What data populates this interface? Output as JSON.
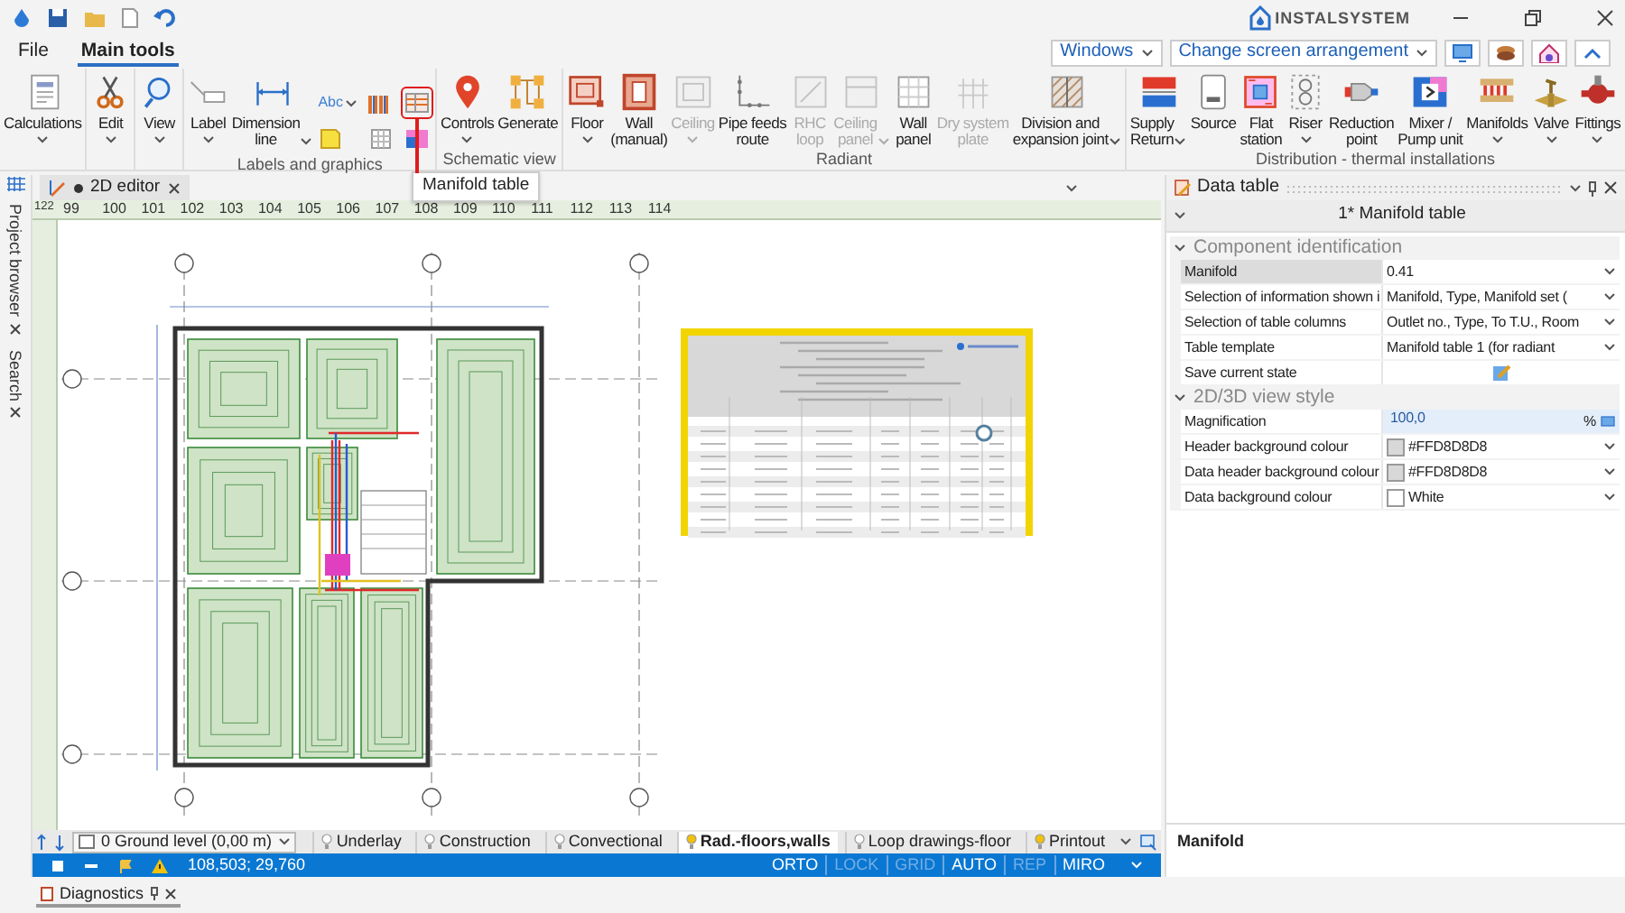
{
  "title_bar": {
    "logo": "INSTALSYSTEM"
  },
  "menu_tabs": [
    {
      "label": "File",
      "selected": false
    },
    {
      "label": "Main tools",
      "selected": true
    }
  ],
  "view_controls": {
    "windows": "Windows",
    "arrangement": "Change screen arrangement"
  },
  "ribbon": [
    {
      "buttons": [
        {
          "label": "Calculations",
          "dropdown": true,
          "disabled": false
        }
      ]
    },
    {
      "buttons": [
        {
          "label": "Edit",
          "dropdown": true,
          "disabled": false
        }
      ]
    },
    {
      "buttons": [
        {
          "label": "View",
          "dropdown": true,
          "disabled": false
        }
      ]
    },
    {
      "label": "Labels and graphics",
      "buttons": [
        {
          "label": "Label",
          "dropdown": true,
          "disabled": false
        },
        {
          "label": "Dimension\nline",
          "dropdown": true,
          "disabled": false
        }
      ],
      "small_tools": [
        {
          "kind": "text",
          "label": "Abc",
          "dropdown": true,
          "highlighted": false
        },
        {
          "kind": "icon",
          "dropdown": false,
          "highlighted": false
        },
        {
          "kind": "icon",
          "dropdown": false,
          "highlighted": true
        },
        {
          "kind": "icon",
          "dropdown": false,
          "highlighted": false
        },
        {
          "kind": "icon",
          "dropdown": false,
          "highlighted": false
        },
        {
          "kind": "icon",
          "dropdown": false,
          "highlighted": false
        }
      ]
    },
    {
      "label": "Schematic view",
      "buttons": [
        {
          "label": "Controls",
          "dropdown": true,
          "disabled": false
        },
        {
          "label": "Generate",
          "dropdown": false,
          "disabled": false
        }
      ]
    },
    {
      "label": "Radiant",
      "buttons": [
        {
          "label": "Floor",
          "dropdown": true,
          "disabled": false
        },
        {
          "label": "Wall\n(manual)",
          "dropdown": false,
          "disabled": false
        },
        {
          "label": "Ceiling",
          "dropdown": true,
          "disabled": true
        },
        {
          "label": "Pipe feeds\nroute",
          "dropdown": false,
          "disabled": false
        },
        {
          "label": "RHC\nloop",
          "dropdown": false,
          "disabled": true
        },
        {
          "label": "Ceiling\npanel",
          "dropdown": true,
          "disabled": true
        },
        {
          "label": "Wall\npanel",
          "dropdown": false,
          "disabled": false
        },
        {
          "label": "Dry system\nplate",
          "dropdown": false,
          "disabled": true
        },
        {
          "label": "Division and\nexpansion joint",
          "dropdown": true,
          "disabled": false
        }
      ]
    },
    {
      "label": "Distribution - thermal installations",
      "buttons": [
        {
          "label": "Supply\nReturn",
          "dropdown": true,
          "disabled": false
        },
        {
          "label": "Source",
          "dropdown": false,
          "disabled": false
        },
        {
          "label": "Flat\nstation",
          "dropdown": false,
          "disabled": false
        },
        {
          "label": "Riser",
          "dropdown": true,
          "disabled": false
        },
        {
          "label": "Reduction\npoint",
          "dropdown": false,
          "disabled": false
        },
        {
          "label": "Mixer /\nPump unit",
          "dropdown": false,
          "disabled": false
        },
        {
          "label": "Manifolds",
          "dropdown": true,
          "disabled": false
        },
        {
          "label": "Valve",
          "dropdown": true,
          "disabled": false
        },
        {
          "label": "Fittings",
          "dropdown": true,
          "disabled": false
        }
      ]
    }
  ],
  "tooltip": "Manifold table",
  "side_tabs": [
    {
      "label": "Project browser"
    },
    {
      "label": "Search"
    }
  ],
  "editor_tab": {
    "label": "2D editor",
    "modified": true
  },
  "ruler": {
    "corner": "122",
    "marks": [
      "99",
      "100",
      "101",
      "102",
      "103",
      "104",
      "105",
      "106",
      "107",
      "108",
      "109",
      "110",
      "111",
      "112",
      "113",
      "114"
    ]
  },
  "level": "0 Ground  level (0,00 m)",
  "layers": [
    {
      "label": "Underlay",
      "selected": false,
      "lit": false
    },
    {
      "label": "Construction",
      "selected": false,
      "lit": false
    },
    {
      "label": "Convectional",
      "selected": false,
      "lit": false
    },
    {
      "label": "Rad.-floors,walls",
      "selected": true,
      "lit": true
    },
    {
      "label": "Loop drawings-floor",
      "selected": false,
      "lit": false
    },
    {
      "label": "Printout",
      "selected": false,
      "lit": true
    }
  ],
  "status": {
    "coordinates": "108,503; 29,760",
    "modes": [
      {
        "label": "ORTO",
        "on": true
      },
      {
        "label": "LOCK",
        "on": false
      },
      {
        "label": "GRID",
        "on": false
      },
      {
        "label": "AUTO",
        "on": true
      },
      {
        "label": "REP",
        "on": false
      },
      {
        "label": "MIRO",
        "on": true
      }
    ]
  },
  "data_table": {
    "title": "Data table",
    "object": "1* Manifold table",
    "sections": [
      {
        "label": "Component identification",
        "expanded": true,
        "rows": [
          {
            "name": "Manifold",
            "kind": "dropdown",
            "value": "0.41",
            "selected": true
          },
          {
            "name": "Selection of information shown i",
            "kind": "dropdown",
            "value": "Manifold, Type, Manifold set (",
            "selected": false
          },
          {
            "name": "Selection of table columns",
            "kind": "dropdown",
            "value": "Outlet no., Type, To T.U., Room",
            "selected": false
          },
          {
            "name": "Table template",
            "kind": "dropdown",
            "value": "Manifold table 1 (for radiant",
            "selected": false
          },
          {
            "name": "Save current state",
            "kind": "button",
            "selected": false
          }
        ]
      },
      {
        "label": "2D/3D view style",
        "expanded": true,
        "rows": [
          {
            "name": "Magnification",
            "kind": "number",
            "value": "100,0",
            "unit": "%",
            "selected": false
          },
          {
            "name": "Header background colour",
            "kind": "color",
            "value": "#FFD8D8D8",
            "color": "#d8d8d8",
            "selected": false
          },
          {
            "name": "Data header background colour",
            "kind": "color",
            "value": "#FFD8D8D8",
            "color": "#d8d8d8",
            "selected": false
          },
          {
            "name": "Data background colour",
            "kind": "color",
            "value": "White",
            "color": "#ffffff",
            "selected": false
          }
        ]
      }
    ],
    "description": "Manifold"
  },
  "bottom_tabs": [
    {
      "label": "Diagnostics"
    }
  ]
}
